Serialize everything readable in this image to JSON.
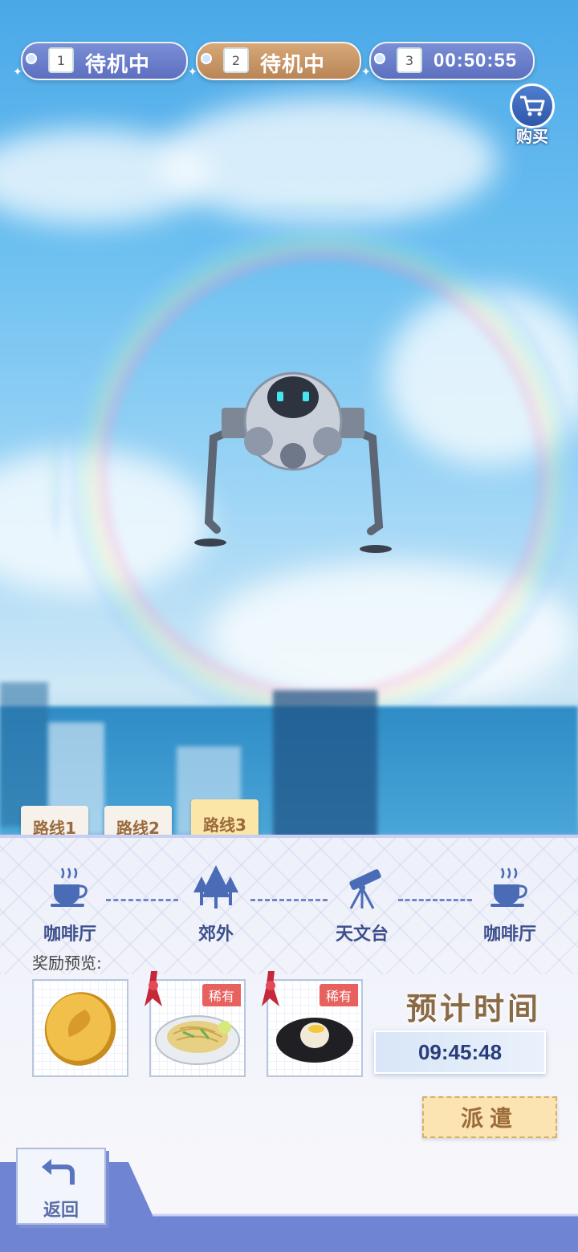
{
  "slots": [
    {
      "number": "1",
      "status": "待机中",
      "style": "blue"
    },
    {
      "number": "2",
      "status": "待机中",
      "style": "gold"
    },
    {
      "number": "3",
      "status": "00:50:55",
      "style": "blue"
    }
  ],
  "buy": {
    "label": "购买",
    "icon": "cart-icon"
  },
  "route_tabs": [
    {
      "label": "路线1",
      "active": false
    },
    {
      "label": "路线2",
      "active": false
    },
    {
      "label": "路线3",
      "active": true
    }
  ],
  "route_stops": [
    {
      "label": "咖啡厅",
      "icon": "coffee-cup-icon"
    },
    {
      "label": "郊外",
      "icon": "trees-icon"
    },
    {
      "label": "天文台",
      "icon": "telescope-icon"
    },
    {
      "label": "咖啡厅",
      "icon": "coffee-cup-icon"
    }
  ],
  "rewards": {
    "title": "奖励预览:",
    "items": [
      {
        "icon": "gold-coin-icon",
        "badge": ""
      },
      {
        "icon": "noodle-dish-icon",
        "badge": "稀有"
      },
      {
        "icon": "rice-dish-icon",
        "badge": "稀有"
      }
    ]
  },
  "eta": {
    "title": "预计时间",
    "value": "09:45:48"
  },
  "dispatch_label": "派遣",
  "back_label": "返回",
  "colors": {
    "accent_blue": "#5d6fbf",
    "accent_gold": "#b88556",
    "rare_red": "#e7615f"
  }
}
